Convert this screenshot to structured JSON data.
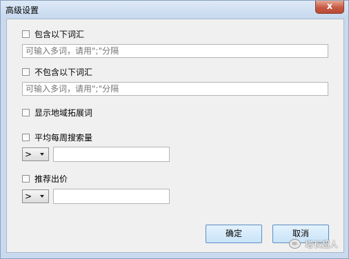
{
  "window": {
    "title": "高级设置",
    "close_glyph": "x"
  },
  "include_words": {
    "label": "包含以下词汇",
    "checked": false,
    "placeholder": "可输入多词，请用\";\"分隔"
  },
  "exclude_words": {
    "label": "不包含以下词汇",
    "checked": false,
    "placeholder": "可输入多词，请用\";\"分隔"
  },
  "show_region_ext": {
    "label": "显示地域拓展词",
    "checked": false
  },
  "avg_weekly_search": {
    "label": "平均每周搜索量",
    "checked": false,
    "operator": ">",
    "value": ""
  },
  "recommended_bid": {
    "label": "推荐出价",
    "checked": false,
    "operator": ">",
    "value": ""
  },
  "buttons": {
    "ok": "确定",
    "cancel": "取消"
  },
  "watermark": {
    "text": "增长超人",
    "icon": "wechat-icon"
  }
}
